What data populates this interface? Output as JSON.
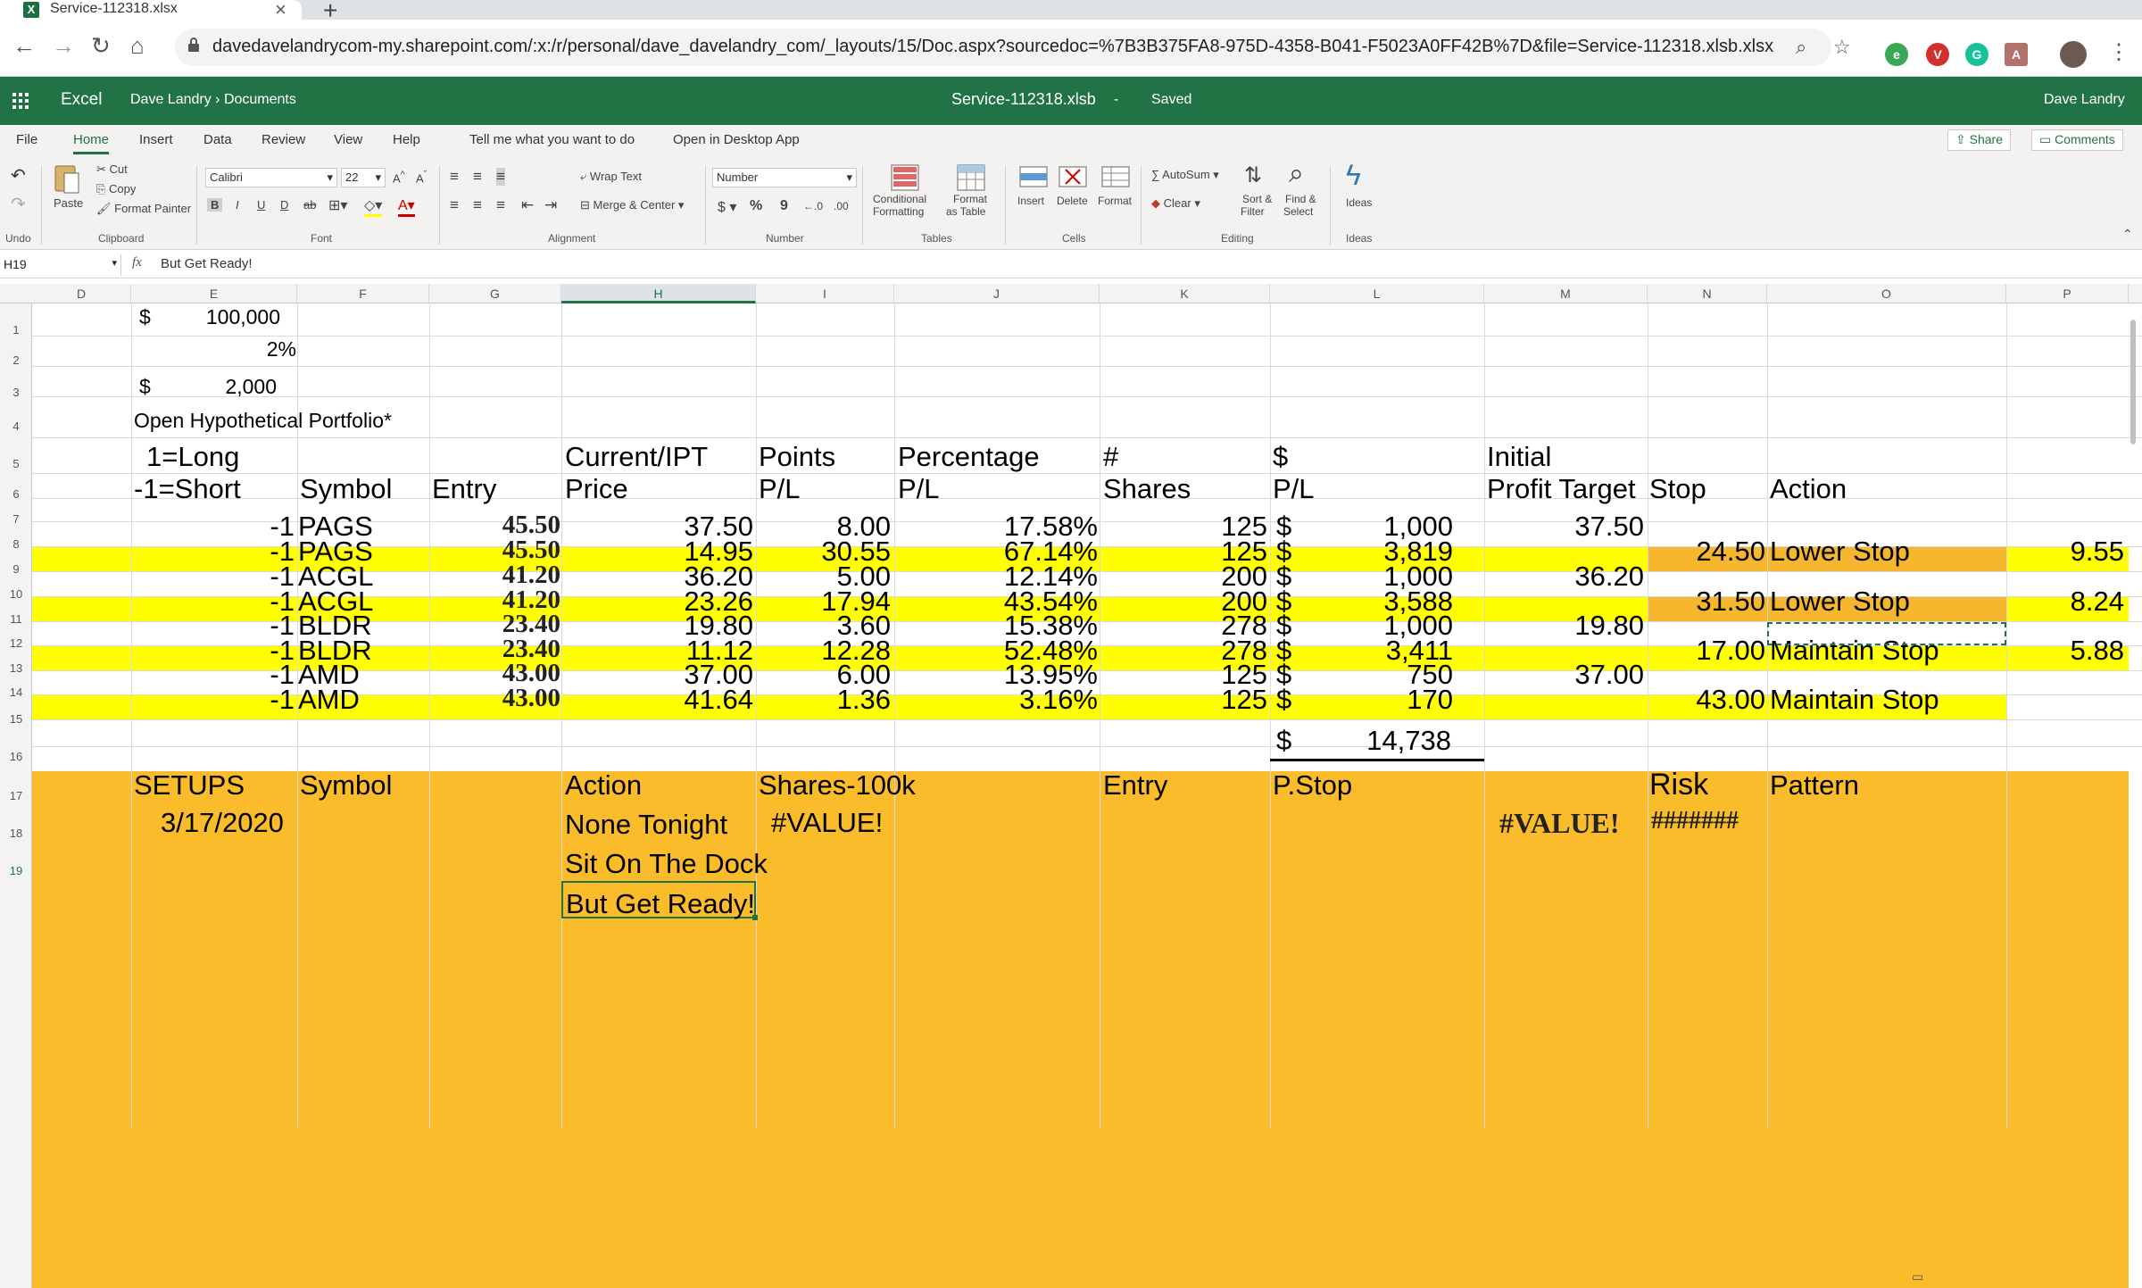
{
  "browser": {
    "tab_title": "Service-112318.xlsx",
    "tab_icon": "X",
    "url": "davedavelandrycom-my.sharepoint.com/:x:/r/personal/dave_davelandry_com/_layouts/15/Doc.aspx?sourcedoc=%7B3B375FA8-975D-4358-B041-F5023A0FF42B%7D&file=Service-112318.xlsb.xlsx&wdOr..."
  },
  "excel": {
    "app": "Excel",
    "owner": "Dave Landry",
    "folder": "Documents",
    "doc_title": "Service-112318.xlsb",
    "status": "Saved",
    "user": "Dave Landry",
    "accent": "#217346"
  },
  "menu": {
    "tabs": [
      "File",
      "Home",
      "Insert",
      "Data",
      "Review",
      "View",
      "Help"
    ],
    "tell_me": "Tell me what you want to do",
    "open_desktop": "Open in Desktop App",
    "share": "Share",
    "comments": "Comments"
  },
  "ribbon": {
    "undo": "Undo",
    "paste": "Paste",
    "cut": "Cut",
    "copy": "Copy",
    "format_painter": "Format Painter",
    "clipboard": "Clipboard",
    "font_name": "Calibri",
    "font_size": "22",
    "font": "Font",
    "wrap_text": "Wrap Text",
    "merge_center": "Merge & Center",
    "alignment": "Alignment",
    "number_format": "Number",
    "number": "Number",
    "conditional": "Conditional",
    "formatting": "Formatting",
    "format_as": "Format",
    "as_table": "as Table",
    "tables": "Tables",
    "insert": "Insert",
    "delete": "Delete",
    "format": "Format",
    "cells": "Cells",
    "autosum": "AutoSum",
    "clear": "Clear",
    "sort_filter_1": "Sort &",
    "sort_filter_2": "Filter",
    "find_select_1": "Find &",
    "find_select_2": "Select",
    "editing": "Editing",
    "ideas": "Ideas",
    "ideas_group": "Ideas"
  },
  "formula_bar": {
    "name_box": "H19",
    "fx": "fx",
    "value": "But Get Ready!"
  },
  "columns": [
    "D",
    "E",
    "F",
    "G",
    "H",
    "I",
    "J",
    "K",
    "L",
    "M",
    "N",
    "O",
    "P"
  ],
  "rows": [
    "1",
    "2",
    "3",
    "4",
    "5",
    "6",
    "7",
    "8",
    "9",
    "10",
    "11",
    "12",
    "13",
    "14",
    "15",
    "16",
    "17",
    "18",
    "19"
  ],
  "sheet": {
    "r1": {
      "dollar": "$",
      "value": "100,000"
    },
    "r2": {
      "value": "2%"
    },
    "r3": {
      "dollar": "$",
      "value": "2,000"
    },
    "r4": {
      "title": "Open Hypothetical Portfolio*"
    },
    "r5": {
      "e": "1=Long",
      "h": "Current/IPT",
      "i": "Points",
      "j": "Percentage",
      "k": "#",
      "l": "$",
      "m": "Initial"
    },
    "r6": {
      "e": "-1=Short",
      "f": "Symbol",
      "g": "Entry",
      "h": "Price",
      "i": "P/L",
      "j": "P/L",
      "k": "Shares",
      "l": "P/L",
      "m": "Profit Target",
      "n": "Stop",
      "o": "Action"
    },
    "trades": [
      {
        "dir": "-1",
        "sym": "PAGS",
        "entry": "45.50",
        "price": "37.50",
        "pts": "8.00",
        "pct": "17.58%",
        "shares": "125",
        "cur": "$",
        "pl": "1,000",
        "target": "37.50",
        "stop": "",
        "action": "",
        "p": "",
        "hl": false
      },
      {
        "dir": "-1",
        "sym": "PAGS",
        "entry": "45.50",
        "price": "14.95",
        "pts": "30.55",
        "pct": "67.14%",
        "shares": "125",
        "cur": "$",
        "pl": "3,819",
        "target": "",
        "stop": "24.50",
        "action": "Lower Stop",
        "p": "9.55",
        "hl": true,
        "stop_hl": true
      },
      {
        "dir": "-1",
        "sym": "ACGL",
        "entry": "41.20",
        "price": "36.20",
        "pts": "5.00",
        "pct": "12.14%",
        "shares": "200",
        "cur": "$",
        "pl": "1,000",
        "target": "36.20",
        "stop": "",
        "action": "",
        "p": "",
        "hl": false
      },
      {
        "dir": "-1",
        "sym": "ACGL",
        "entry": "41.20",
        "price": "23.26",
        "pts": "17.94",
        "pct": "43.54%",
        "shares": "200",
        "cur": "$",
        "pl": "3,588",
        "target": "",
        "stop": "31.50",
        "action": "Lower Stop",
        "p": "8.24",
        "hl": true,
        "stop_hl": true
      },
      {
        "dir": "-1",
        "sym": "BLDR",
        "entry": "23.40",
        "price": "19.80",
        "pts": "3.60",
        "pct": "15.38%",
        "shares": "278",
        "cur": "$",
        "pl": "1,000",
        "target": "19.80",
        "stop": "",
        "action": "",
        "p": "",
        "hl": false
      },
      {
        "dir": "-1",
        "sym": "BLDR",
        "entry": "23.40",
        "price": "11.12",
        "pts": "12.28",
        "pct": "52.48%",
        "shares": "278",
        "cur": "$",
        "pl": "3,411",
        "target": "",
        "stop": "17.00",
        "action": "Maintain Stop",
        "p": "5.88",
        "hl": true
      },
      {
        "dir": "-1",
        "sym": "AMD",
        "entry": "43.00",
        "price": "37.00",
        "pts": "6.00",
        "pct": "13.95%",
        "shares": "125",
        "cur": "$",
        "pl": "750",
        "target": "37.00",
        "stop": "",
        "action": "",
        "p": "",
        "hl": false
      },
      {
        "dir": "-1",
        "sym": "AMD",
        "entry": "43.00",
        "price": "41.64",
        "pts": "1.36",
        "pct": "3.16%",
        "shares": "125",
        "cur": "$",
        "pl": "170",
        "target": "",
        "stop": "43.00",
        "action": "Maintain Stop",
        "p": "",
        "hl": true
      }
    ],
    "r15": {
      "dollar": "$",
      "total": "14,738"
    },
    "r16": {
      "e": "SETUPS",
      "f": "Symbol",
      "h": "Action",
      "i": "Shares-100k",
      "k": "Entry",
      "l": "P.Stop",
      "n": "Risk",
      "o": "Pattern"
    },
    "r17": {
      "date": "3/17/2020",
      "h": "None Tonight",
      "i": "#VALUE!",
      "m": "#VALUE!",
      "n": "#######"
    },
    "r18": {
      "h": "Sit On The Dock"
    },
    "r19": {
      "h": "But Get Ready!"
    }
  },
  "colors": {
    "highlight_yellow": "#ffff00",
    "highlight_orange": "#f6b72f",
    "setup_orange": "#fbbc2c"
  }
}
